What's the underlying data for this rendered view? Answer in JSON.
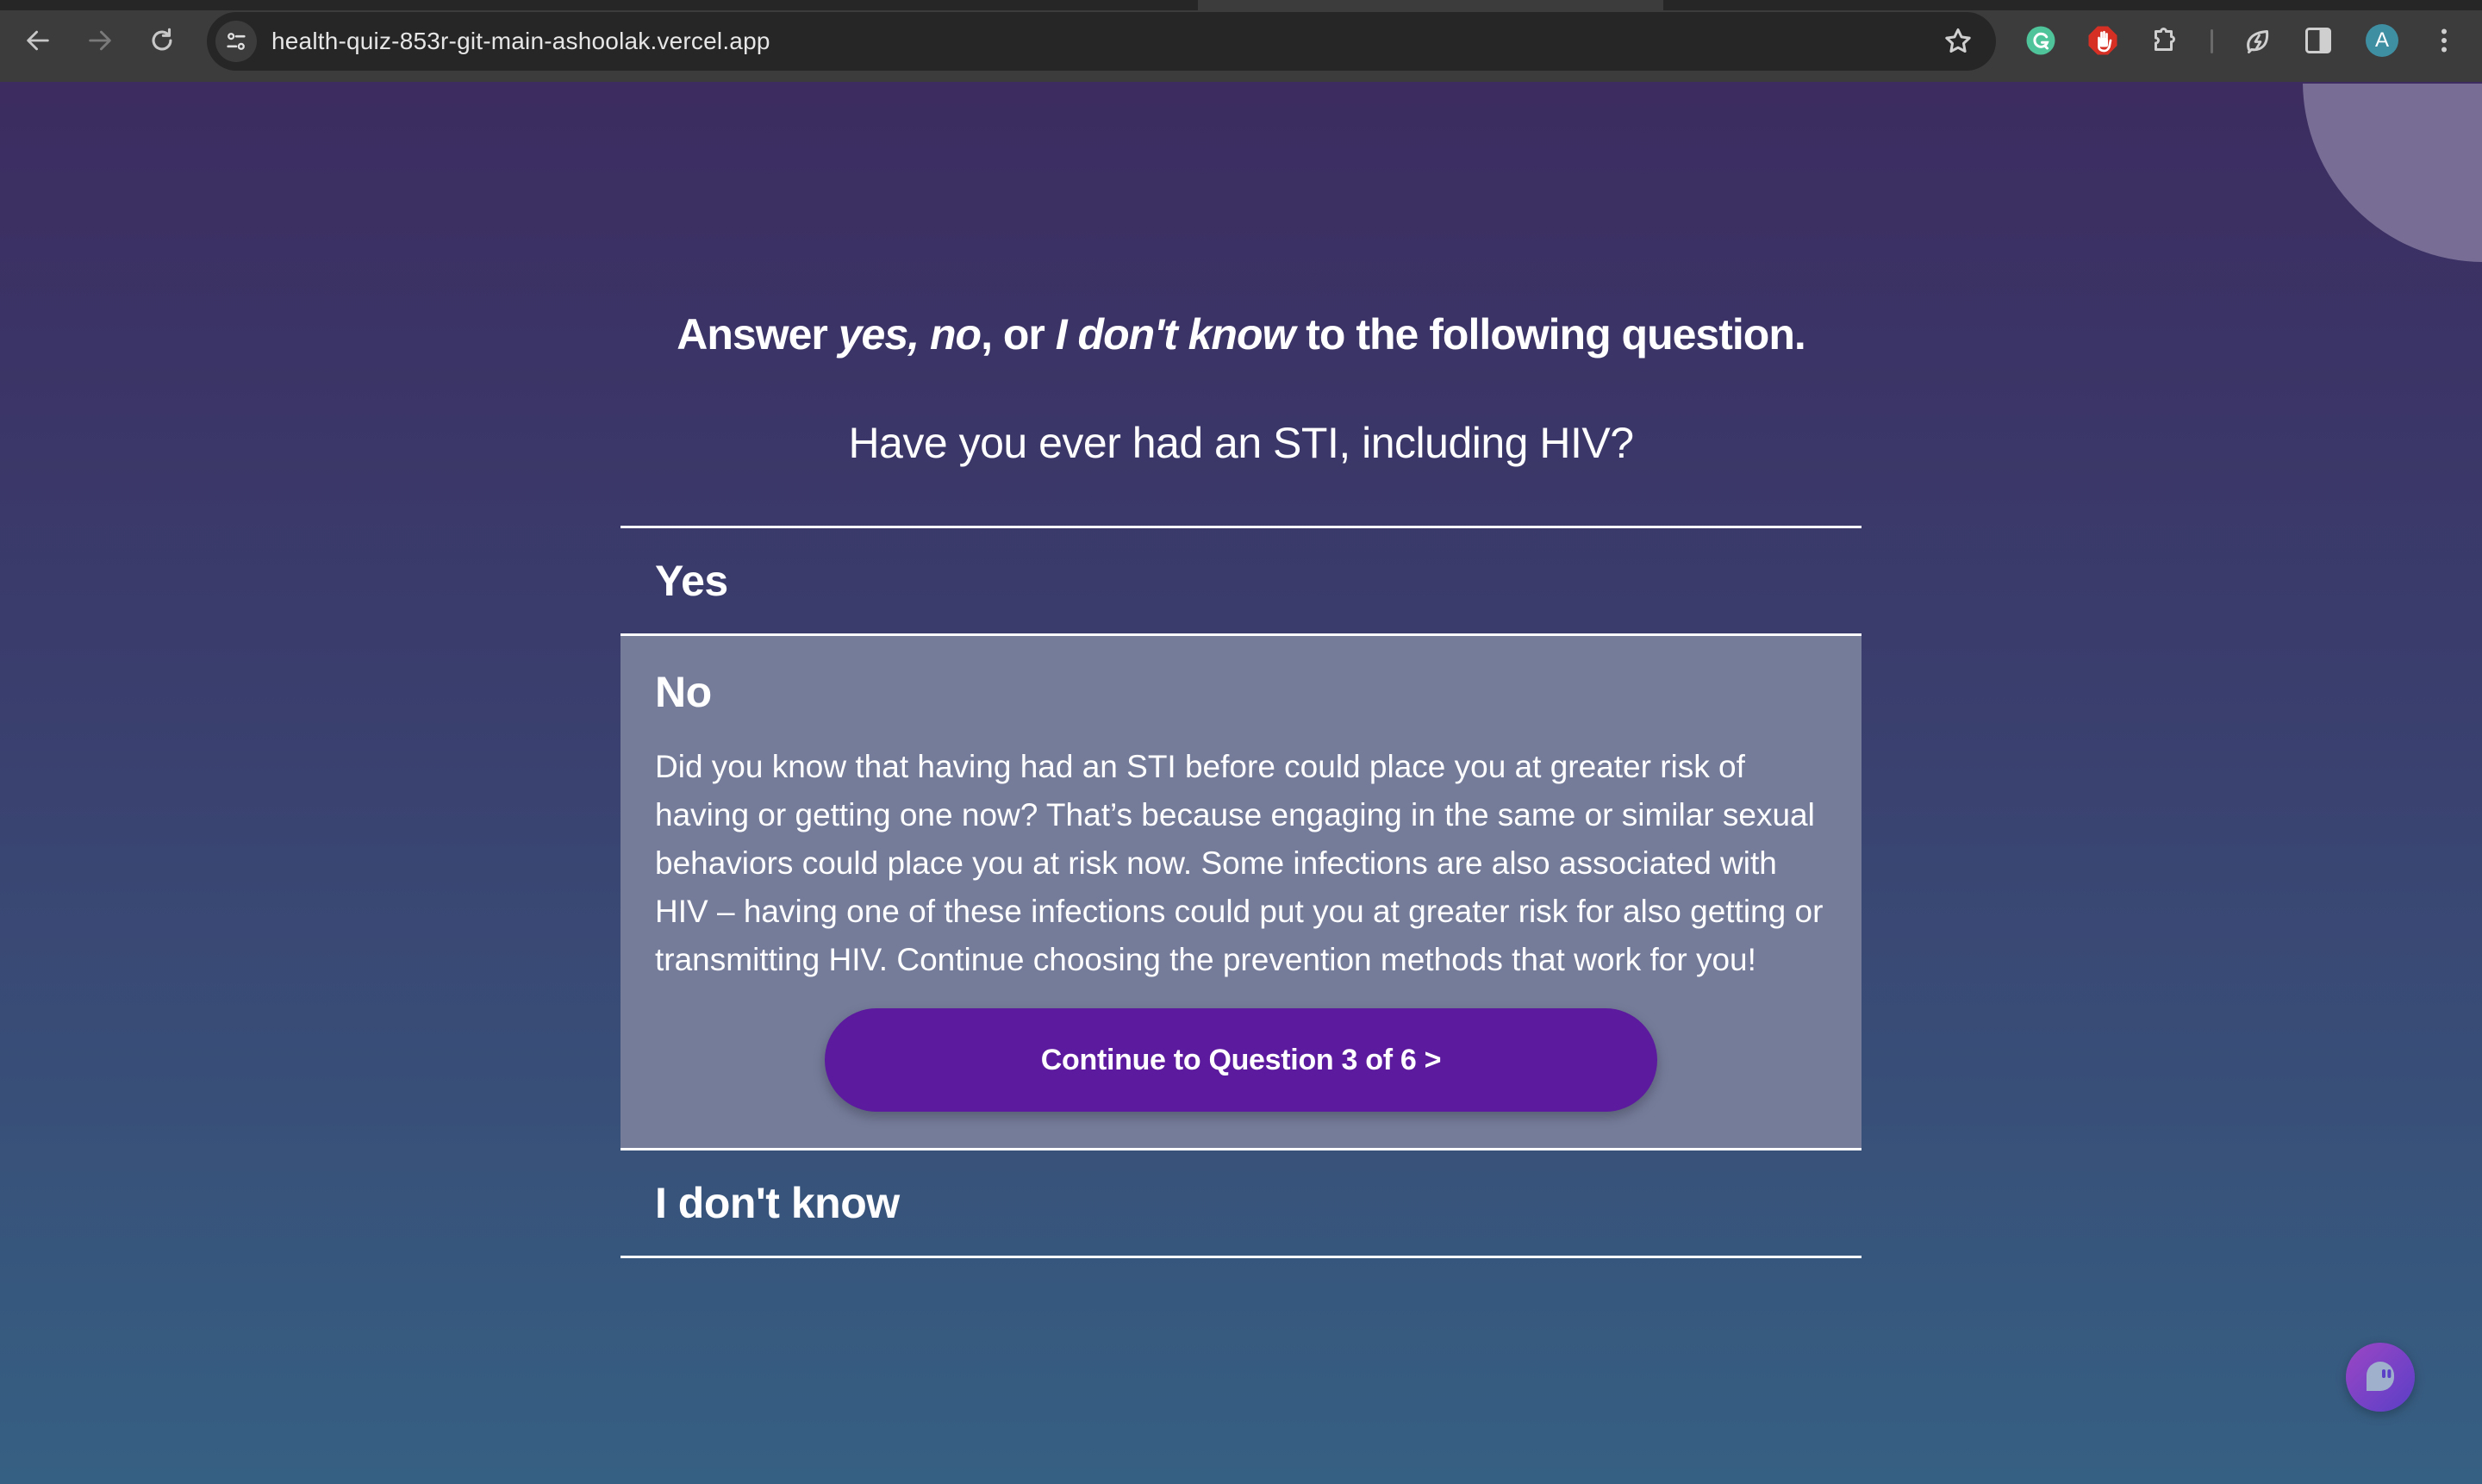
{
  "browser": {
    "url": "health-quiz-853r-git-main-ashoolak.vercel.app",
    "avatar_initial": "A",
    "icons": {
      "back": "arrow-left",
      "forward": "arrow-right",
      "reload": "reload",
      "site_info": "tune",
      "bookmark": "star-outline",
      "extensions": [
        "grammarly",
        "adblock-hand",
        "puzzle-extensions",
        "energy-leaf",
        "side-panel"
      ],
      "menu": "vertical-dots"
    }
  },
  "quiz": {
    "instructions": {
      "prefix": "Answer ",
      "yes": "yes",
      "comma1": ", ",
      "no": "no",
      "comma2": ", or ",
      "idk": "I don't know",
      "suffix": " to the following question."
    },
    "question": "Have you ever had an STI, including HIV?",
    "answers": [
      {
        "label": "Yes",
        "selected": false
      },
      {
        "label": "No",
        "selected": true,
        "feedback": "Did you know that having had an STI before could place you at greater risk of having or getting one now? That’s because engaging in the same or similar sexual behaviors could place you at risk now. Some infections are also associated with HIV – having one of these infections could put you at greater risk for also getting or transmitting HIV. Continue choosing the prevention methods that work for you!",
        "continue_label": "Continue to Question 3 of 6 >"
      },
      {
        "label": "I don't know",
        "selected": false
      }
    ],
    "progress": {
      "next_question": 3,
      "total_questions": 6
    }
  },
  "colors": {
    "bg_top": "#3c2c60",
    "bg_bottom": "#366083",
    "selected_answer_bg": "#757c9a",
    "button_bg": "#5c1a9e",
    "decor_circle": "#776d95",
    "chat_bubble": "#7b44c6"
  },
  "chat_widget": {
    "icon": "chat-bubble-icon"
  }
}
